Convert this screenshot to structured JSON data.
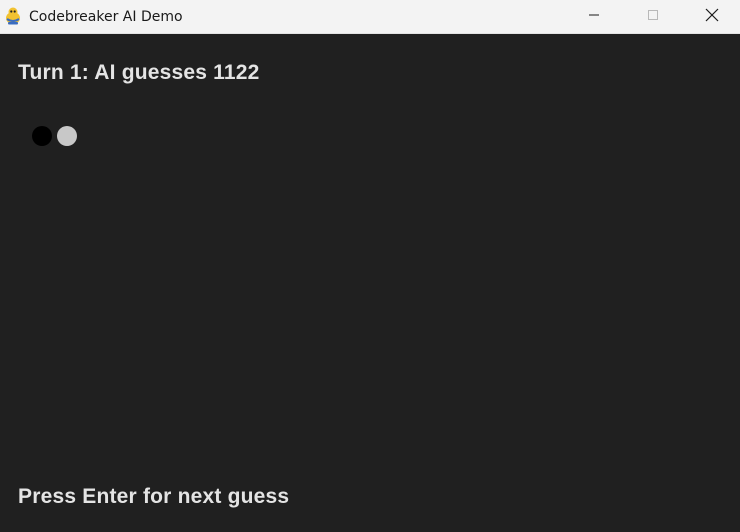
{
  "window": {
    "title": "Codebreaker AI Demo",
    "app_icon": "pygame-snake-icon",
    "controls": [
      "minimize-icon",
      "maximize-icon",
      "close-icon"
    ]
  },
  "game": {
    "turn_text": "Turn 1: AI guesses 1122",
    "feedback_pegs": [
      {
        "kind": "black",
        "color": "#000000"
      },
      {
        "kind": "white",
        "color": "#c8c8c8"
      }
    ],
    "prompt_text": "Press Enter for next guess"
  },
  "colors": {
    "background": "#202020",
    "text": "#e4e4e4",
    "titlebar": "#f3f3f3"
  }
}
